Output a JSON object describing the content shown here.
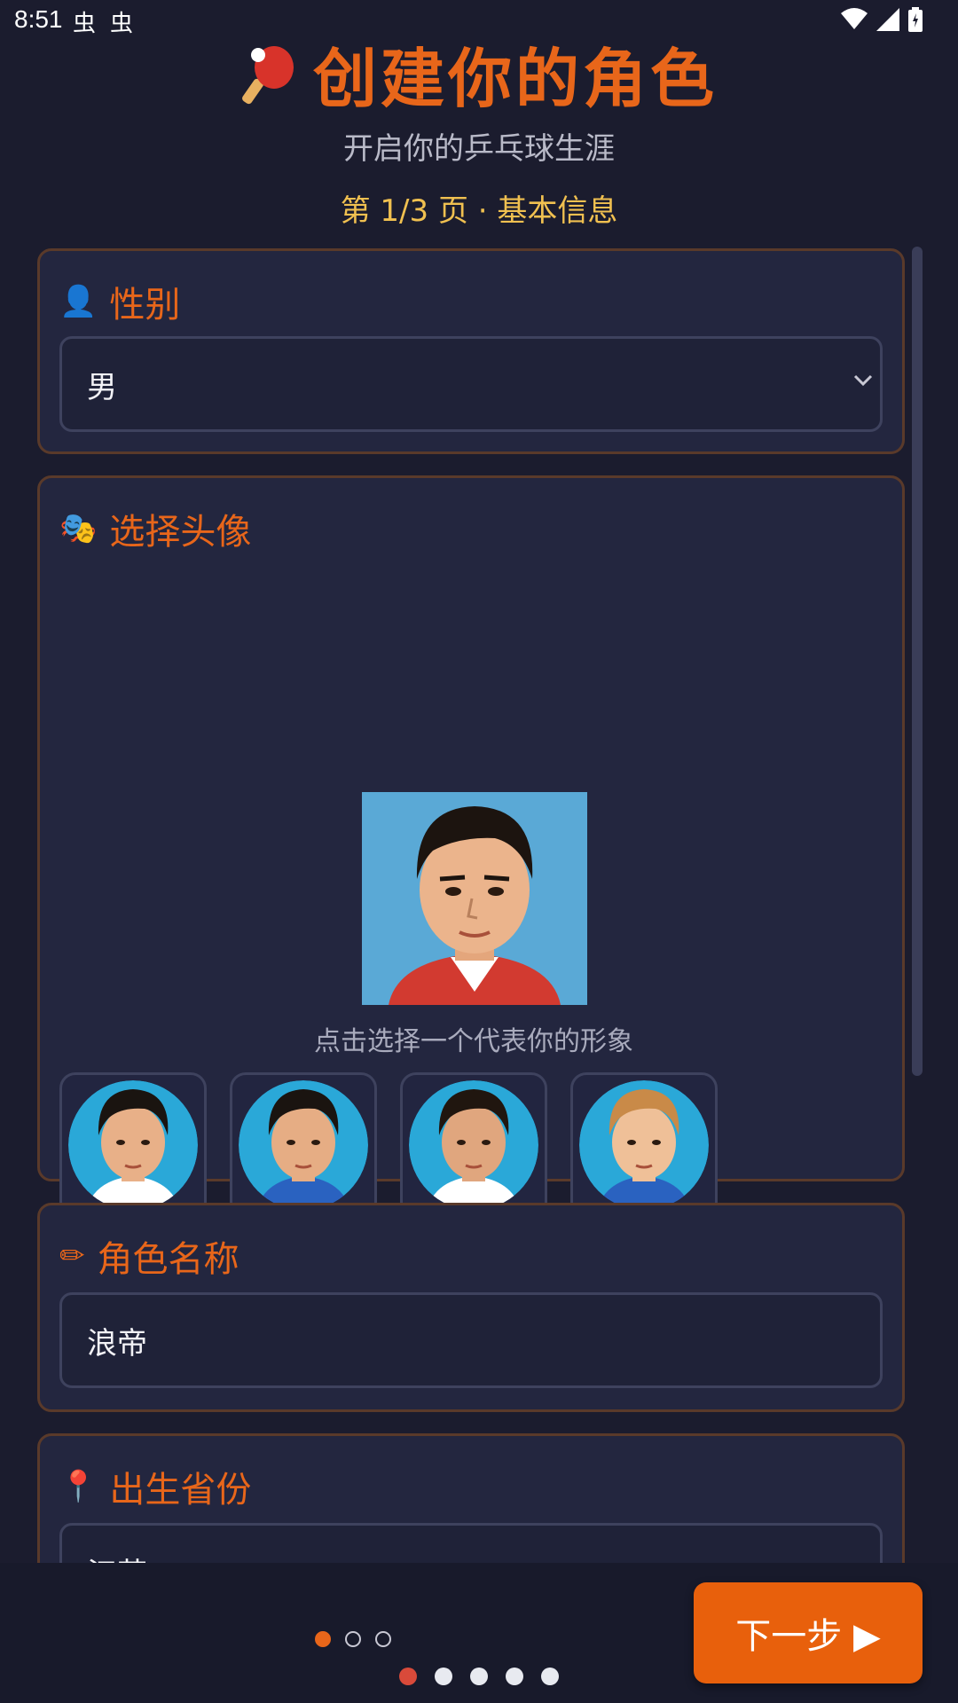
{
  "status_bar": {
    "time": "8:51",
    "notif_glyph": "虫"
  },
  "header": {
    "title": "创建你的角色",
    "subtitle": "开启你的乒乓球生涯",
    "page_note": "第 1/3 页 · 基本信息"
  },
  "gender": {
    "emoji": "👤",
    "label": "性别",
    "value": "男"
  },
  "avatar": {
    "emoji": "🎭",
    "label": "选择头像",
    "hint": "点击选择一个代表你的形象",
    "selected_index": 6,
    "options": [
      {
        "hair": "#1a1410",
        "skin": "#e8b088",
        "shirt": "#ffffff"
      },
      {
        "hair": "#1a1410",
        "skin": "#e6ad84",
        "shirt": "#2a62c0"
      },
      {
        "hair": "#20160f",
        "skin": "#e0a67e",
        "shirt": "#ffffff"
      },
      {
        "hair": "#c98a48",
        "skin": "#efc098",
        "shirt": "#2a62c0"
      },
      {
        "hair": "#15110e",
        "skin": "#e8b088",
        "shirt": "#ffffff"
      },
      {
        "hair": "#1c140f",
        "skin": "#e4aa82",
        "shirt": "#ffffff"
      },
      {
        "hair": "#1c140f",
        "skin": "#ebb48c",
        "shirt": "#ffffff"
      },
      {
        "hair": "#15110e",
        "skin": "#e8b088",
        "shirt": "#ffffff"
      }
    ]
  },
  "name": {
    "emoji": "✏",
    "label": "角色名称",
    "value": "浪帝"
  },
  "province": {
    "emoji": "📍",
    "label": "出生省份",
    "value": "江苏"
  },
  "footer": {
    "next_label": "下一步 ▶",
    "step_dots": [
      true,
      false,
      false
    ]
  },
  "nav_dots": [
    true,
    false,
    false,
    false,
    false
  ],
  "colors": {
    "accent": "#e8661a",
    "background": "#1b1c2e",
    "card": "#23263f",
    "gold": "#f0c050"
  }
}
